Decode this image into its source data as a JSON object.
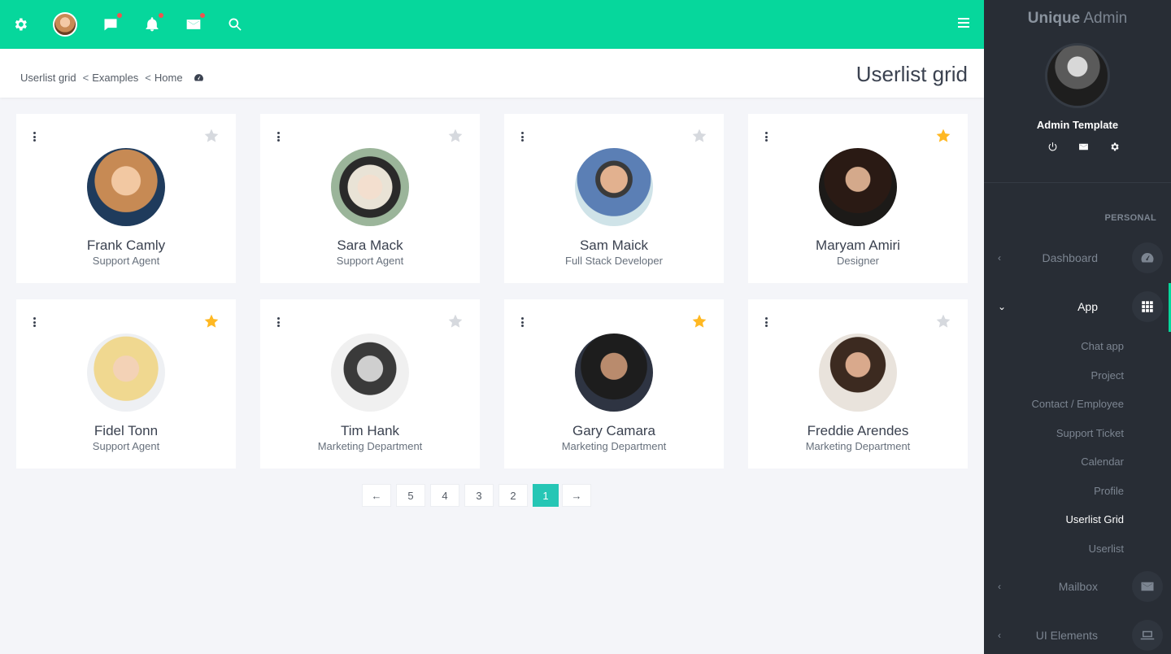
{
  "topbar": {
    "icons": [
      "gear-icon",
      "avatar",
      "chat-icon",
      "bell-icon",
      "mail-icon",
      "search-icon",
      "hamburger-icon"
    ],
    "accent": "#06d79c"
  },
  "breadcrumb": {
    "items": [
      "Userlist grid",
      "Examples",
      "Home"
    ],
    "separator": "<"
  },
  "page": {
    "title": "Userlist grid"
  },
  "users": [
    {
      "name": "Frank Camly",
      "role": "Support Agent",
      "starred": false
    },
    {
      "name": "Sara Mack",
      "role": "Support Agent",
      "starred": false
    },
    {
      "name": "Sam Maick",
      "role": "Full Stack Developer",
      "starred": false
    },
    {
      "name": "Maryam Amiri",
      "role": "Designer",
      "starred": true
    },
    {
      "name": "Fidel Tonn",
      "role": "Support Agent",
      "starred": true
    },
    {
      "name": "Tim Hank",
      "role": "Marketing Department",
      "starred": false
    },
    {
      "name": "Gary Camara",
      "role": "Marketing Department",
      "starred": true
    },
    {
      "name": "Freddie Arendes",
      "role": "Marketing Department",
      "starred": false
    }
  ],
  "pagination": {
    "prev": "←",
    "pages": [
      "5",
      "4",
      "3",
      "2",
      "1"
    ],
    "active": "1",
    "next": "→"
  },
  "sidebar": {
    "brand_bold": "Unique",
    "brand_rest": "Admin",
    "user": "Admin Template",
    "section": "PERSONAL",
    "items": [
      {
        "label": "Dashboard",
        "icon": "dashboard-icon",
        "open": false
      },
      {
        "label": "App",
        "icon": "apps-grid-icon",
        "open": true
      },
      {
        "label": "Mailbox",
        "icon": "mail-icon",
        "open": false
      },
      {
        "label": "UI Elements",
        "icon": "laptop-icon",
        "open": false
      }
    ],
    "app_subitems": [
      "Chat app",
      "Project",
      "Contact / Employee",
      "Support Ticket",
      "Calendar",
      "Profile",
      "Userlist Grid",
      "Userlist"
    ],
    "current_subitem": "Userlist Grid"
  },
  "colors": {
    "star_active": "#ffb822",
    "star_inactive": "#d6d9de",
    "page_active": "#26c6b5"
  }
}
